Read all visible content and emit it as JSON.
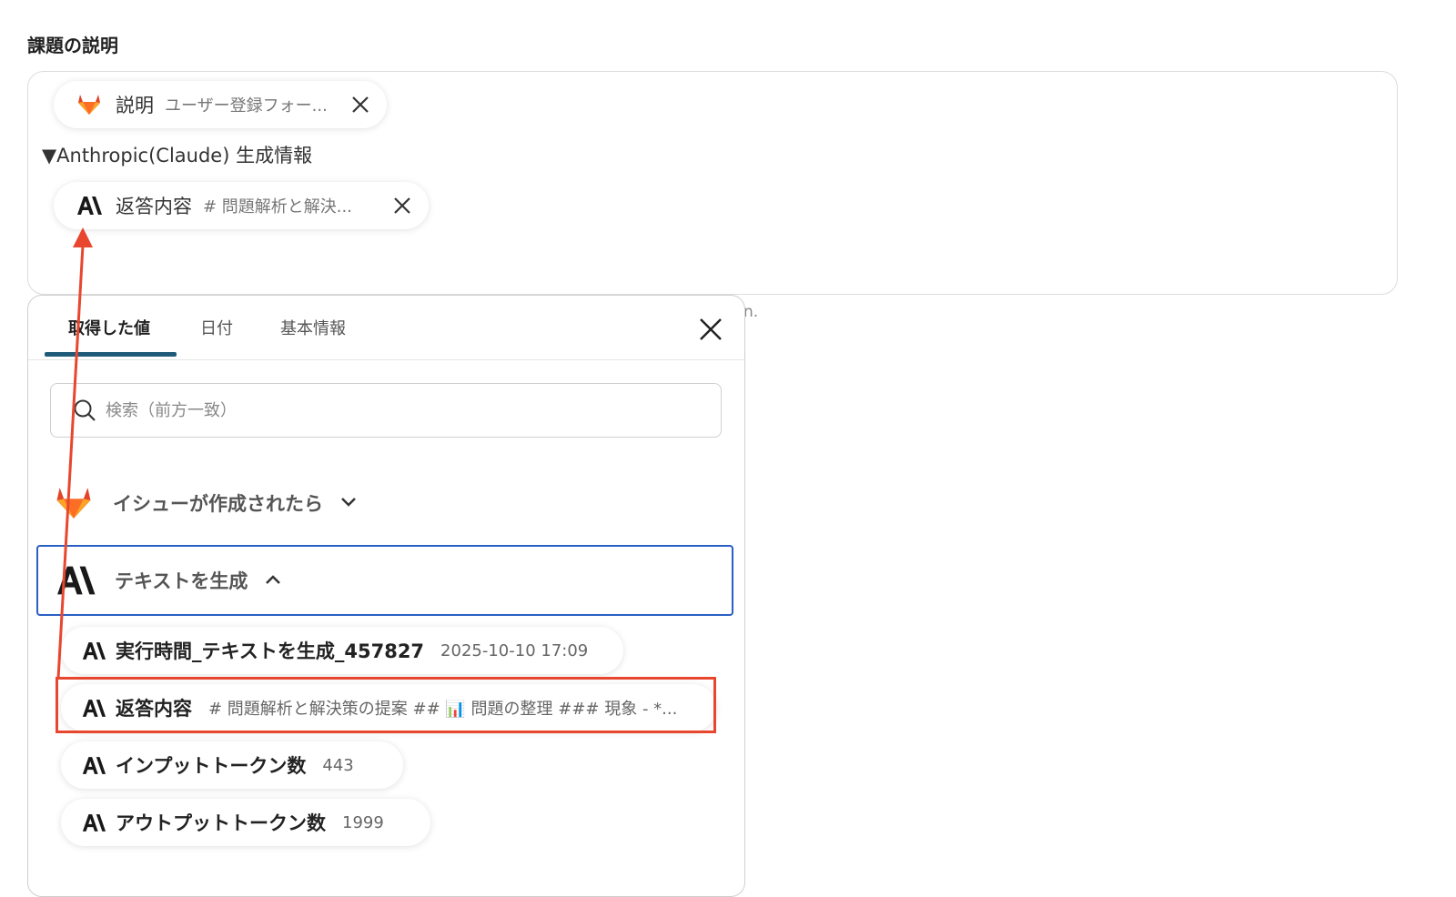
{
  "field": {
    "label": "課題の説明",
    "description_pill": {
      "label": "説明",
      "value": "ユーザー登録フォー..."
    },
    "section_heading": "▼Anthropic(Claude) 生成情報",
    "response_pill": {
      "label": "返答内容",
      "value": "# 問題解析と解決..."
    },
    "aside_text": "n."
  },
  "panel": {
    "tabs": [
      {
        "label": "取得した値"
      },
      {
        "label": "日付"
      },
      {
        "label": "基本情報"
      }
    ],
    "search": {
      "placeholder": "検索（前方一致）"
    },
    "groups": [
      {
        "label": "イシューが作成されたら",
        "icon": "gitlab-icon",
        "expanded": false
      },
      {
        "label": "テキストを生成",
        "icon": "anthropic-icon",
        "expanded": true
      }
    ],
    "items": [
      {
        "label": "実行時間_テキストを生成_457827",
        "value": "2025-10-10 17:09"
      },
      {
        "label": "返答内容",
        "value": "# 問題解析と解決策の提案 ## 📊 問題の整理 ### 現象 - *..."
      },
      {
        "label": "インプットトークン数",
        "value": "443"
      },
      {
        "label": "アウトプットトークン数",
        "value": "1999"
      }
    ]
  },
  "colors": {
    "accent_tab": "#1f5a78",
    "selected_border": "#2a5fc4",
    "annotation_red": "#e8462f",
    "gitlab_orange": "#e24329"
  }
}
